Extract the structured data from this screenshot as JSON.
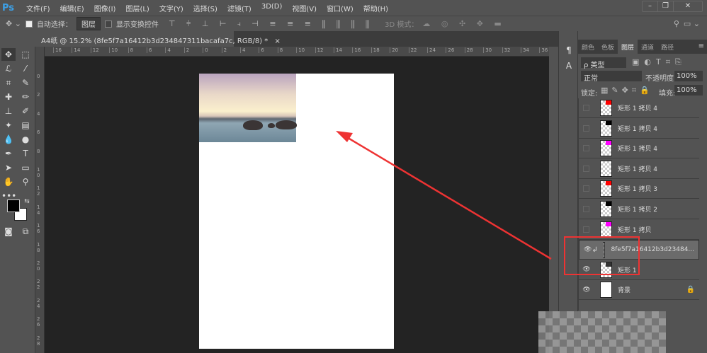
{
  "app": {
    "logo": "Ps"
  },
  "menu": [
    "文件(F)",
    "编辑(E)",
    "图像(I)",
    "图层(L)",
    "文字(Y)",
    "选择(S)",
    "滤镜(T)",
    "3D(D)",
    "视图(V)",
    "窗口(W)",
    "帮助(H)"
  ],
  "window_controls": [
    "–",
    "❐",
    "✕"
  ],
  "options": {
    "auto_select_label": "自动选择：",
    "auto_select_value": "图层",
    "show_transform_label": "显示变换控件",
    "mode_3d_label": "3D 模式："
  },
  "document": {
    "tab_title": "A4纸 @ 15.2% (8fe5f7a16412b3d234847311bacafa7c, RGB/8) *",
    "close": "×"
  },
  "ruler_top": [
    "16",
    "14",
    "12",
    "10",
    "8",
    "6",
    "4",
    "2",
    "0",
    "2",
    "4",
    "6",
    "8",
    "10",
    "12",
    "14",
    "16",
    "18",
    "20",
    "22",
    "24",
    "26",
    "28",
    "30",
    "32",
    "34",
    "36"
  ],
  "ruler_left": [
    "0",
    "2",
    "4",
    "6",
    "8",
    "10",
    "12",
    "14",
    "16",
    "18",
    "20",
    "22",
    "24",
    "26",
    "28"
  ],
  "panel": {
    "tabs": [
      "颜色",
      "色板",
      "图层",
      "通道",
      "路径"
    ],
    "active_tab": "图层",
    "filter_label": "ρ 类型",
    "blend_mode": "正常",
    "opacity_label": "不透明度:",
    "opacity_value": "100%",
    "lock_label": "锁定:",
    "fill_label": "填充:",
    "fill_value": "100%",
    "layers": [
      {
        "name": "矩形 1 拷贝 4",
        "visible": false,
        "swatch": "#ff0000"
      },
      {
        "name": "矩形 1 拷贝 4",
        "visible": false,
        "swatch": "#000000"
      },
      {
        "name": "矩形 1 拷贝 4",
        "visible": false,
        "swatch": "#ff00ff"
      },
      {
        "name": "矩形 1 拷贝 4",
        "visible": false,
        "swatch": ""
      },
      {
        "name": "矩形 1 拷贝 3",
        "visible": false,
        "swatch": "#ff0000"
      },
      {
        "name": "矩形 1 拷贝 2",
        "visible": false,
        "swatch": "#000000"
      },
      {
        "name": "矩形 1 拷贝",
        "visible": false,
        "swatch": "#ff00ff"
      },
      {
        "name": "8fe5f7a16412b3d23484...",
        "visible": true,
        "swatch": "",
        "selected": true
      },
      {
        "name": "矩形 1",
        "visible": true,
        "swatch": "#333333"
      },
      {
        "name": "背景",
        "visible": true,
        "swatch": "",
        "locked": true
      }
    ]
  },
  "colors": {
    "annotation": "#ee3333"
  }
}
